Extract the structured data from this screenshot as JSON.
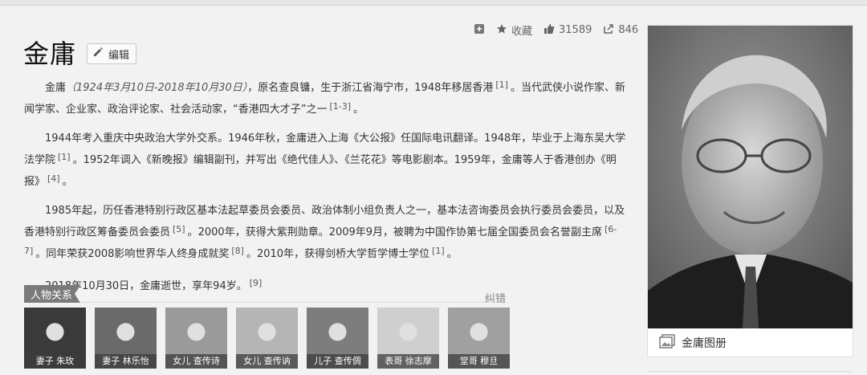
{
  "title": "金庸",
  "edit_label": "编辑",
  "toolbar": {
    "add_icon": "plus-square-icon",
    "favorite_label": "收藏",
    "like_count": "31589",
    "share_count": "846"
  },
  "paragraphs": [
    {
      "parts": [
        {
          "t": "text",
          "v": "金庸"
        },
        {
          "t": "date",
          "v": "（1924年3月10日-2018年10月30日）"
        },
        {
          "t": "text",
          "v": "，原名查良镛，生于浙江省海宁市，1948年移居香港"
        },
        {
          "t": "sup",
          "v": "[1]"
        },
        {
          "t": "text",
          "v": "。当代武侠小说作家、新闻学家、企业家、政治评论家、社会活动家，“香港四大才子”之一"
        },
        {
          "t": "sup",
          "v": "[1-3]"
        },
        {
          "t": "text",
          "v": "。"
        }
      ]
    },
    {
      "parts": [
        {
          "t": "text",
          "v": "1944年考入重庆中央政治大学外交系。1946年秋，金庸进入上海《大公报》任国际电讯翻译。1948年，毕业于上海东吴大学法学院"
        },
        {
          "t": "sup",
          "v": "[1]"
        },
        {
          "t": "text",
          "v": "。1952年调入《新晚报》编辑副刊，并写出《绝代佳人》、《兰花花》等电影剧本。1959年，金庸等人于香港创办《明报》"
        },
        {
          "t": "sup",
          "v": "[4]"
        },
        {
          "t": "text",
          "v": "。"
        }
      ]
    },
    {
      "parts": [
        {
          "t": "text",
          "v": "1985年起，历任香港特别行政区基本法起草委员会委员、政治体制小组负责人之一，基本法咨询委员会执行委员会委员，以及香港特别行政区筹备委员会委员"
        },
        {
          "t": "sup",
          "v": "[5]"
        },
        {
          "t": "text",
          "v": "。2000年，获得大紫荆勋章。2009年9月，被聘为中国作协第七届全国委员会名誉副主席"
        },
        {
          "t": "sup",
          "v": "[6-7]"
        },
        {
          "t": "text",
          "v": "。同年荣获2008影响世界华人终身成就奖"
        },
        {
          "t": "sup",
          "v": "[8]"
        },
        {
          "t": "text",
          "v": "。2010年，获得剑桥大学哲学博士学位"
        },
        {
          "t": "sup",
          "v": "[1]"
        },
        {
          "t": "text",
          "v": "。"
        }
      ]
    },
    {
      "parts": [
        {
          "t": "text",
          "v": "2018年10月30日，金庸逝世，享年94岁。"
        },
        {
          "t": "sup",
          "v": "[9]"
        }
      ]
    }
  ],
  "relations": {
    "tag": "人物关系",
    "correct": "纠错",
    "people": [
      {
        "label": "妻子 朱玫",
        "shade": "#3a3a3a"
      },
      {
        "label": "妻子 林乐怡",
        "shade": "#6a6a6a"
      },
      {
        "label": "女儿 查传诗",
        "shade": "#9a9a9a"
      },
      {
        "label": "女儿 查传讷",
        "shade": "#b5b5b5"
      },
      {
        "label": "儿子 查传倜",
        "shade": "#7d7d7d"
      },
      {
        "label": "表哥 徐志摩",
        "shade": "#cfcfcf"
      },
      {
        "label": "堂哥 穆旦",
        "shade": "#a0a0a0"
      }
    ]
  },
  "album_label": "金庸图册"
}
